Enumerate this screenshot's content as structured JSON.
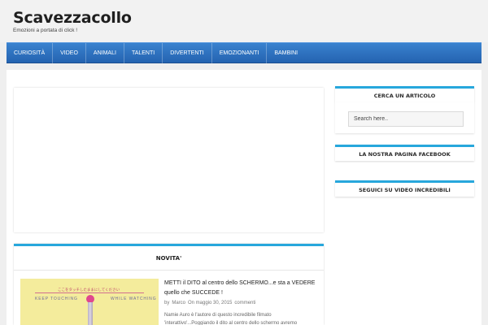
{
  "header": {
    "site_title": "Scavezzacollo",
    "tagline": "Emozioni a portata di click !"
  },
  "nav": {
    "items": [
      {
        "label": "CURIOSITÀ"
      },
      {
        "label": "VIDEO"
      },
      {
        "label": "ANIMALI"
      },
      {
        "label": "TALENTI"
      },
      {
        "label": "DIVERTENTI"
      },
      {
        "label": "EMOZIONANTI"
      },
      {
        "label": "BAMBINI"
      }
    ]
  },
  "main": {
    "section_title": "NOVITA'",
    "post": {
      "thumbnail": {
        "japanese_text": "ここをタッチしたままにしてください",
        "left_text": "KEEP TOUCHING",
        "right_text": "WHILE WATCHING"
      },
      "title": "METTI il DITO al centro dello SCHERMO...e sta a VEDERE quello che SUCCEDE !",
      "meta": {
        "by": "by",
        "author": "Marco",
        "date": "On maggio 30, 2015",
        "comments": "commenti"
      },
      "excerpt": "Namie Auro è l'autore di questo incredibile filmato 'interattivo'...Poggiando il dito al centro dello schermo avremo"
    }
  },
  "sidebar": {
    "search_title": "CERCA UN ARTICOLO",
    "search_placeholder": "Search here..",
    "facebook_title": "LA NOSTRA PAGINA FACEBOOK",
    "video_title": "SEGUICI SU VIDEO INCREDIBILI"
  },
  "colors": {
    "accent": "#27a7dc",
    "nav": "#2463b0"
  }
}
